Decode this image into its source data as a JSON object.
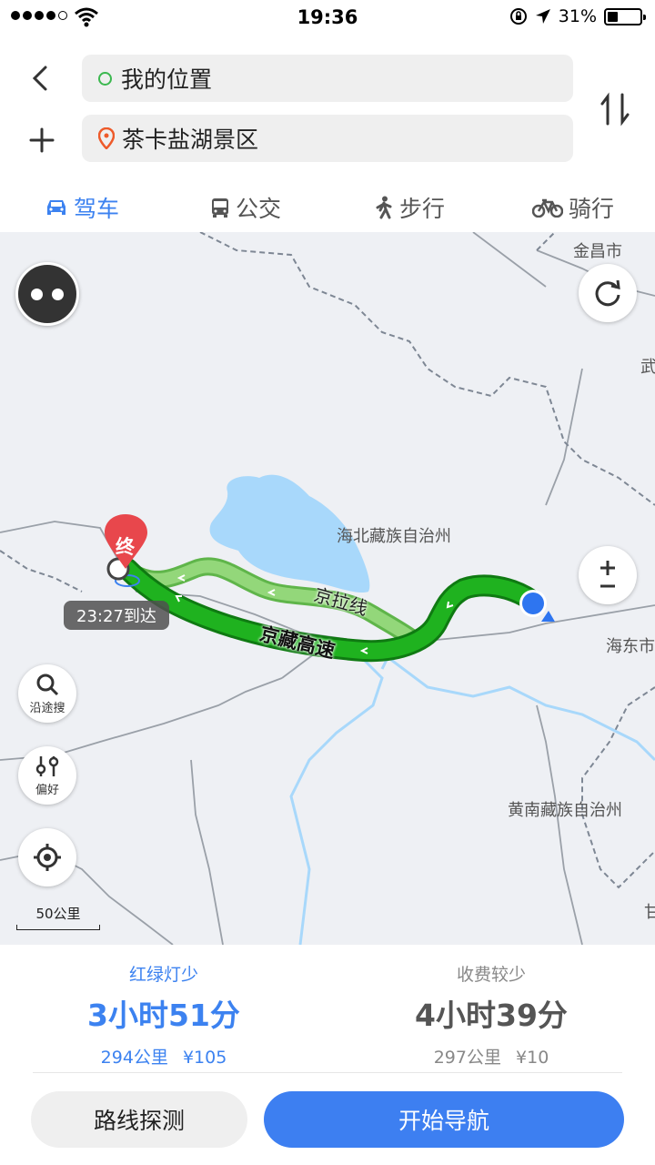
{
  "status_bar": {
    "time": "19:36",
    "battery": "31%",
    "battery_level": 0.31
  },
  "search": {
    "from": "我的位置",
    "to": "茶卡盐湖景区"
  },
  "tabs": [
    {
      "label": "驾车",
      "icon": "car-icon",
      "active": true
    },
    {
      "label": "公交",
      "icon": "bus-icon",
      "active": false
    },
    {
      "label": "步行",
      "icon": "walk-icon",
      "active": false
    },
    {
      "label": "骑行",
      "icon": "bike-icon",
      "active": false
    }
  ],
  "map": {
    "labels": {
      "jinchang": "金昌市",
      "wu": "武",
      "haibei": "海北藏族自治州",
      "haidong": "海东市",
      "huangnan": "黄南藏族自治州",
      "gan": "甘"
    },
    "route_names": {
      "primary": "京藏高速",
      "secondary": "京拉线"
    },
    "destination_marker": "终",
    "eta": "23:27到达",
    "buttons": {
      "along_search": "沿途搜",
      "preference": "偏好"
    },
    "scale": "50公里"
  },
  "routes": [
    {
      "tag": "红绿灯少",
      "duration": "3小时51分",
      "distance": "294公里",
      "toll": "¥105",
      "selected": true
    },
    {
      "tag": "收费较少",
      "duration": "4小时39分",
      "distance": "297公里",
      "toll": "¥10",
      "selected": false
    }
  ],
  "actions": {
    "probe": "路线探测",
    "navigate": "开始导航"
  },
  "colors": {
    "accent": "#3c82f0",
    "route": "#1fb21f",
    "route_alt": "#93d77a",
    "water": "#a8d8fb",
    "marker": "#e8474c"
  }
}
